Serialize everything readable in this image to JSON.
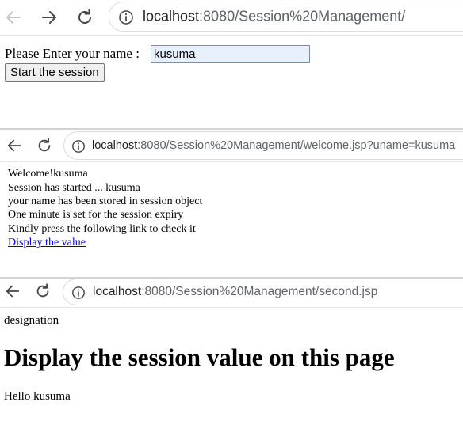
{
  "window1": {
    "url_host": "localhost",
    "url_path": ":8080/Session%20Management/",
    "label": "Please Enter your name :",
    "name_value": "kusuma",
    "button_label": "Start the session"
  },
  "window2": {
    "url_host": "localhost",
    "url_path": ":8080/Session%20Management/welcome.jsp?uname=kusuma",
    "lines": [
      "Welcome!kusuma",
      "Session has started ... kusuma",
      "your name has been stored in session object",
      "One minute is set for the session expiry",
      "Kindly press the following link to check it"
    ],
    "link_text": "Display the value"
  },
  "window3": {
    "url_host": "localhost",
    "url_path": ":8080/Session%20Management/second.jsp",
    "designation": "designation",
    "heading": "Display the session value on this page",
    "greeting": "Hello kusuma"
  },
  "colors": {
    "link": "#0000ee",
    "input_bg": "#e8f0fe",
    "nav_icon": "#444746",
    "nav_icon_disabled": "#c4c7c5"
  },
  "icons": [
    "back-arrow-icon",
    "forward-arrow-icon",
    "reload-icon",
    "info-icon"
  ]
}
